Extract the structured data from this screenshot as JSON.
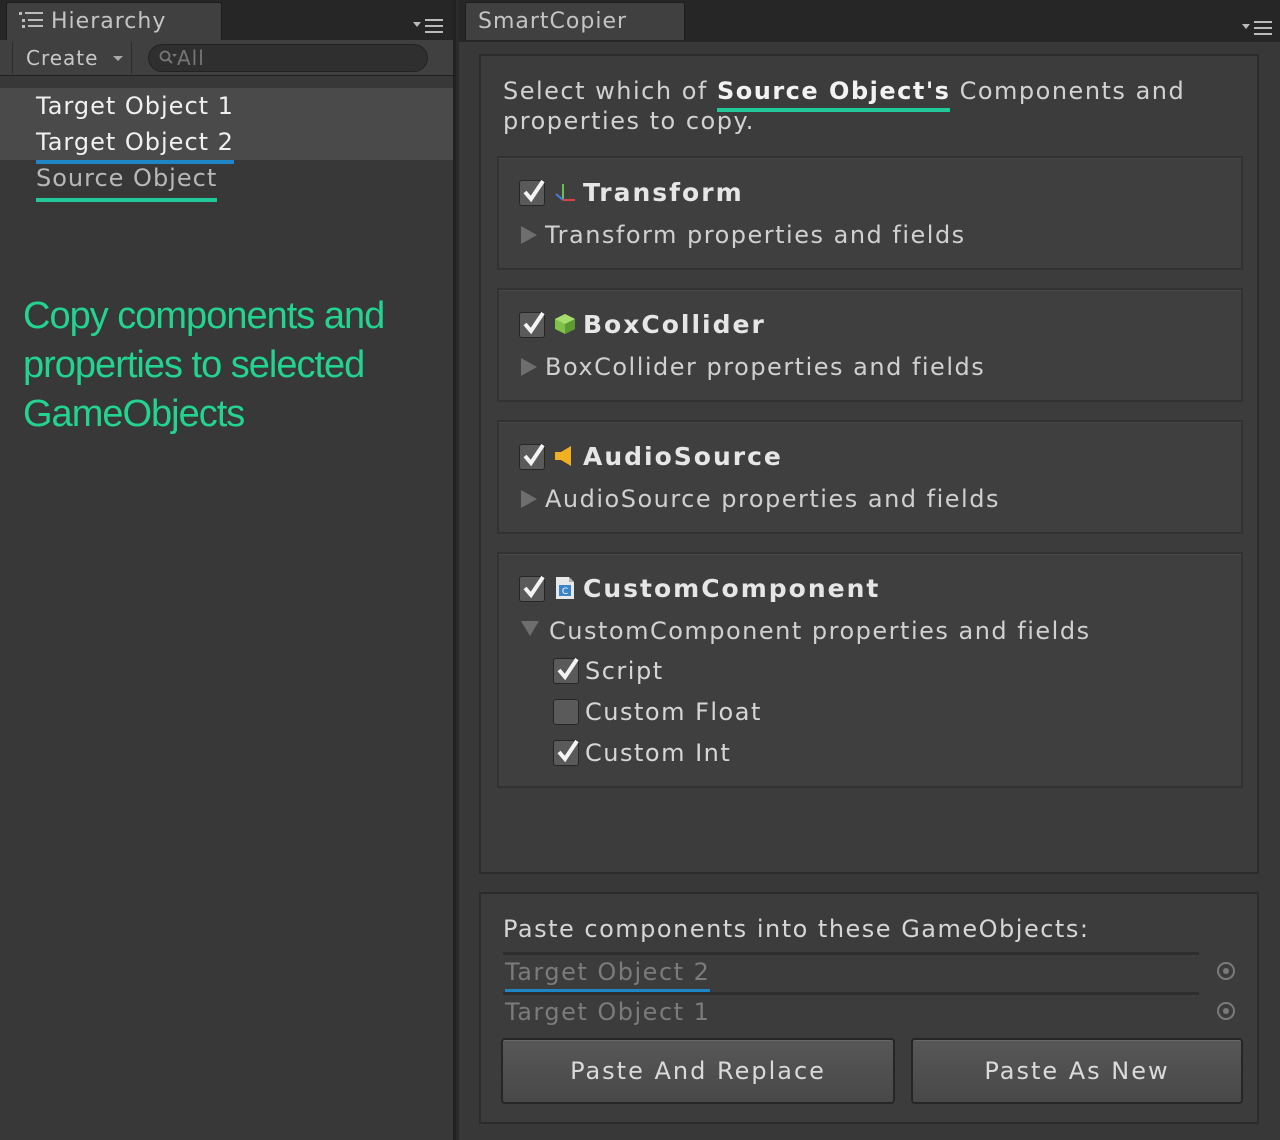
{
  "hierarchy": {
    "tab_title": "Hierarchy",
    "create_label": "Create",
    "search_placeholder": "All",
    "items": [
      {
        "label": "Target Object 1"
      },
      {
        "label": "Target Object 2"
      },
      {
        "label": "Source Object"
      }
    ]
  },
  "caption": "Copy components and properties to selected GameObjects",
  "smartcopier": {
    "tab_title": "SmartCopier",
    "intro_prefix": "Select which of ",
    "intro_source": "Source Object's",
    "intro_suffix": " Components and properties to copy.",
    "components": [
      {
        "name": "Transform",
        "icon": "transform-icon",
        "checked": true,
        "expanded": false,
        "subtitle": "Transform properties and fields"
      },
      {
        "name": "BoxCollider",
        "icon": "box-collider-icon",
        "checked": true,
        "expanded": false,
        "subtitle": "BoxCollider properties and fields"
      },
      {
        "name": "AudioSource",
        "icon": "audio-source-icon",
        "checked": true,
        "expanded": false,
        "subtitle": "AudioSource properties and fields"
      },
      {
        "name": "CustomComponent",
        "icon": "script-icon",
        "checked": true,
        "expanded": true,
        "subtitle": "CustomComponent properties and fields",
        "properties": [
          {
            "label": "Script",
            "checked": true
          },
          {
            "label": "Custom Float",
            "checked": false
          },
          {
            "label": "Custom Int",
            "checked": true
          }
        ]
      }
    ],
    "paste_label": "Paste components into these GameObjects:",
    "targets": [
      {
        "label": "Target Object 2"
      },
      {
        "label": "Target Object 1"
      }
    ],
    "paste_replace_label": "Paste And Replace",
    "paste_new_label": "Paste As New"
  },
  "colors": {
    "accent_teal": "#21c99a",
    "accent_blue": "#1f86c5",
    "caption_green": "#22d48f",
    "panel_bg": "#383838"
  }
}
